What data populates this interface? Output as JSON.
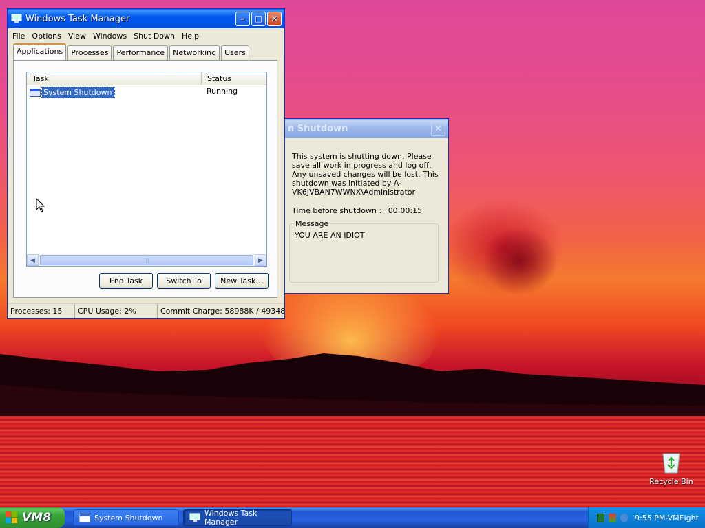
{
  "task_manager": {
    "title": "Windows Task Manager",
    "menu": [
      "File",
      "Options",
      "View",
      "Windows",
      "Shut Down",
      "Help"
    ],
    "tabs": [
      "Applications",
      "Processes",
      "Performance",
      "Networking",
      "Users"
    ],
    "active_tab": "Applications",
    "columns": [
      "Task",
      "Status"
    ],
    "rows": [
      {
        "task": "System Shutdown",
        "status": "Running"
      }
    ],
    "buttons": {
      "end_task": "End Task",
      "switch_to": "Switch To",
      "new_task": "New Task..."
    },
    "status": {
      "processes": "Processes: 15",
      "cpu": "CPU Usage: 2%",
      "commit": "Commit Charge: 58988K / 49348"
    }
  },
  "shutdown_dialog": {
    "title": "n Shutdown",
    "body": "This system is shutting down. Please save all work in progress and log off. Any unsaved changes will be lost. This shutdown was initiated by A-VK6JVBAN7WWNX\\Administrator",
    "time_label": "Time before shutdown :",
    "time_value": "00:00:15",
    "message_label": "Message",
    "message_text": "YOU ARE AN IDIOT"
  },
  "desktop": {
    "recycle_bin": "Recycle Bin"
  },
  "taskbar": {
    "start_label": "VM8",
    "items": [
      "System Shutdown",
      "Windows Task Manager"
    ],
    "clock": "9:55 PM-VMEight"
  }
}
